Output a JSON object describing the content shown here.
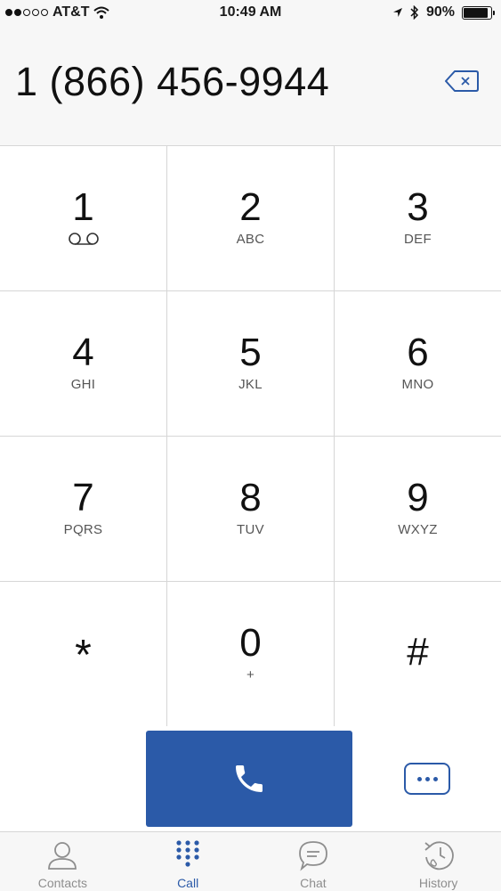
{
  "status_bar": {
    "carrier": "AT&T",
    "time": "10:49 AM",
    "battery": "90%",
    "battery_level": 0.9,
    "signal_bars_filled": 2,
    "signal_bars_total": 5
  },
  "dialer": {
    "number": "1 (866) 456-9944"
  },
  "keypad": [
    {
      "digit": "1",
      "letters": ""
    },
    {
      "digit": "2",
      "letters": "ABC"
    },
    {
      "digit": "3",
      "letters": "DEF"
    },
    {
      "digit": "4",
      "letters": "GHI"
    },
    {
      "digit": "5",
      "letters": "JKL"
    },
    {
      "digit": "6",
      "letters": "MNO"
    },
    {
      "digit": "7",
      "letters": "PQRS"
    },
    {
      "digit": "8",
      "letters": "TUV"
    },
    {
      "digit": "9",
      "letters": "WXYZ"
    },
    {
      "digit": "*",
      "letters": ""
    },
    {
      "digit": "0",
      "letters": "+"
    },
    {
      "digit": "#",
      "letters": ""
    }
  ],
  "tabs": [
    {
      "label": "Contacts",
      "icon": "person-icon"
    },
    {
      "label": "Call",
      "icon": "keypad-icon"
    },
    {
      "label": "Chat",
      "icon": "chat-bubble-icon"
    },
    {
      "label": "History",
      "icon": "clock-history-icon"
    }
  ],
  "active_tab": "Call",
  "colors": {
    "accent": "#2b5aa8",
    "inactive": "#8e8e8e"
  }
}
